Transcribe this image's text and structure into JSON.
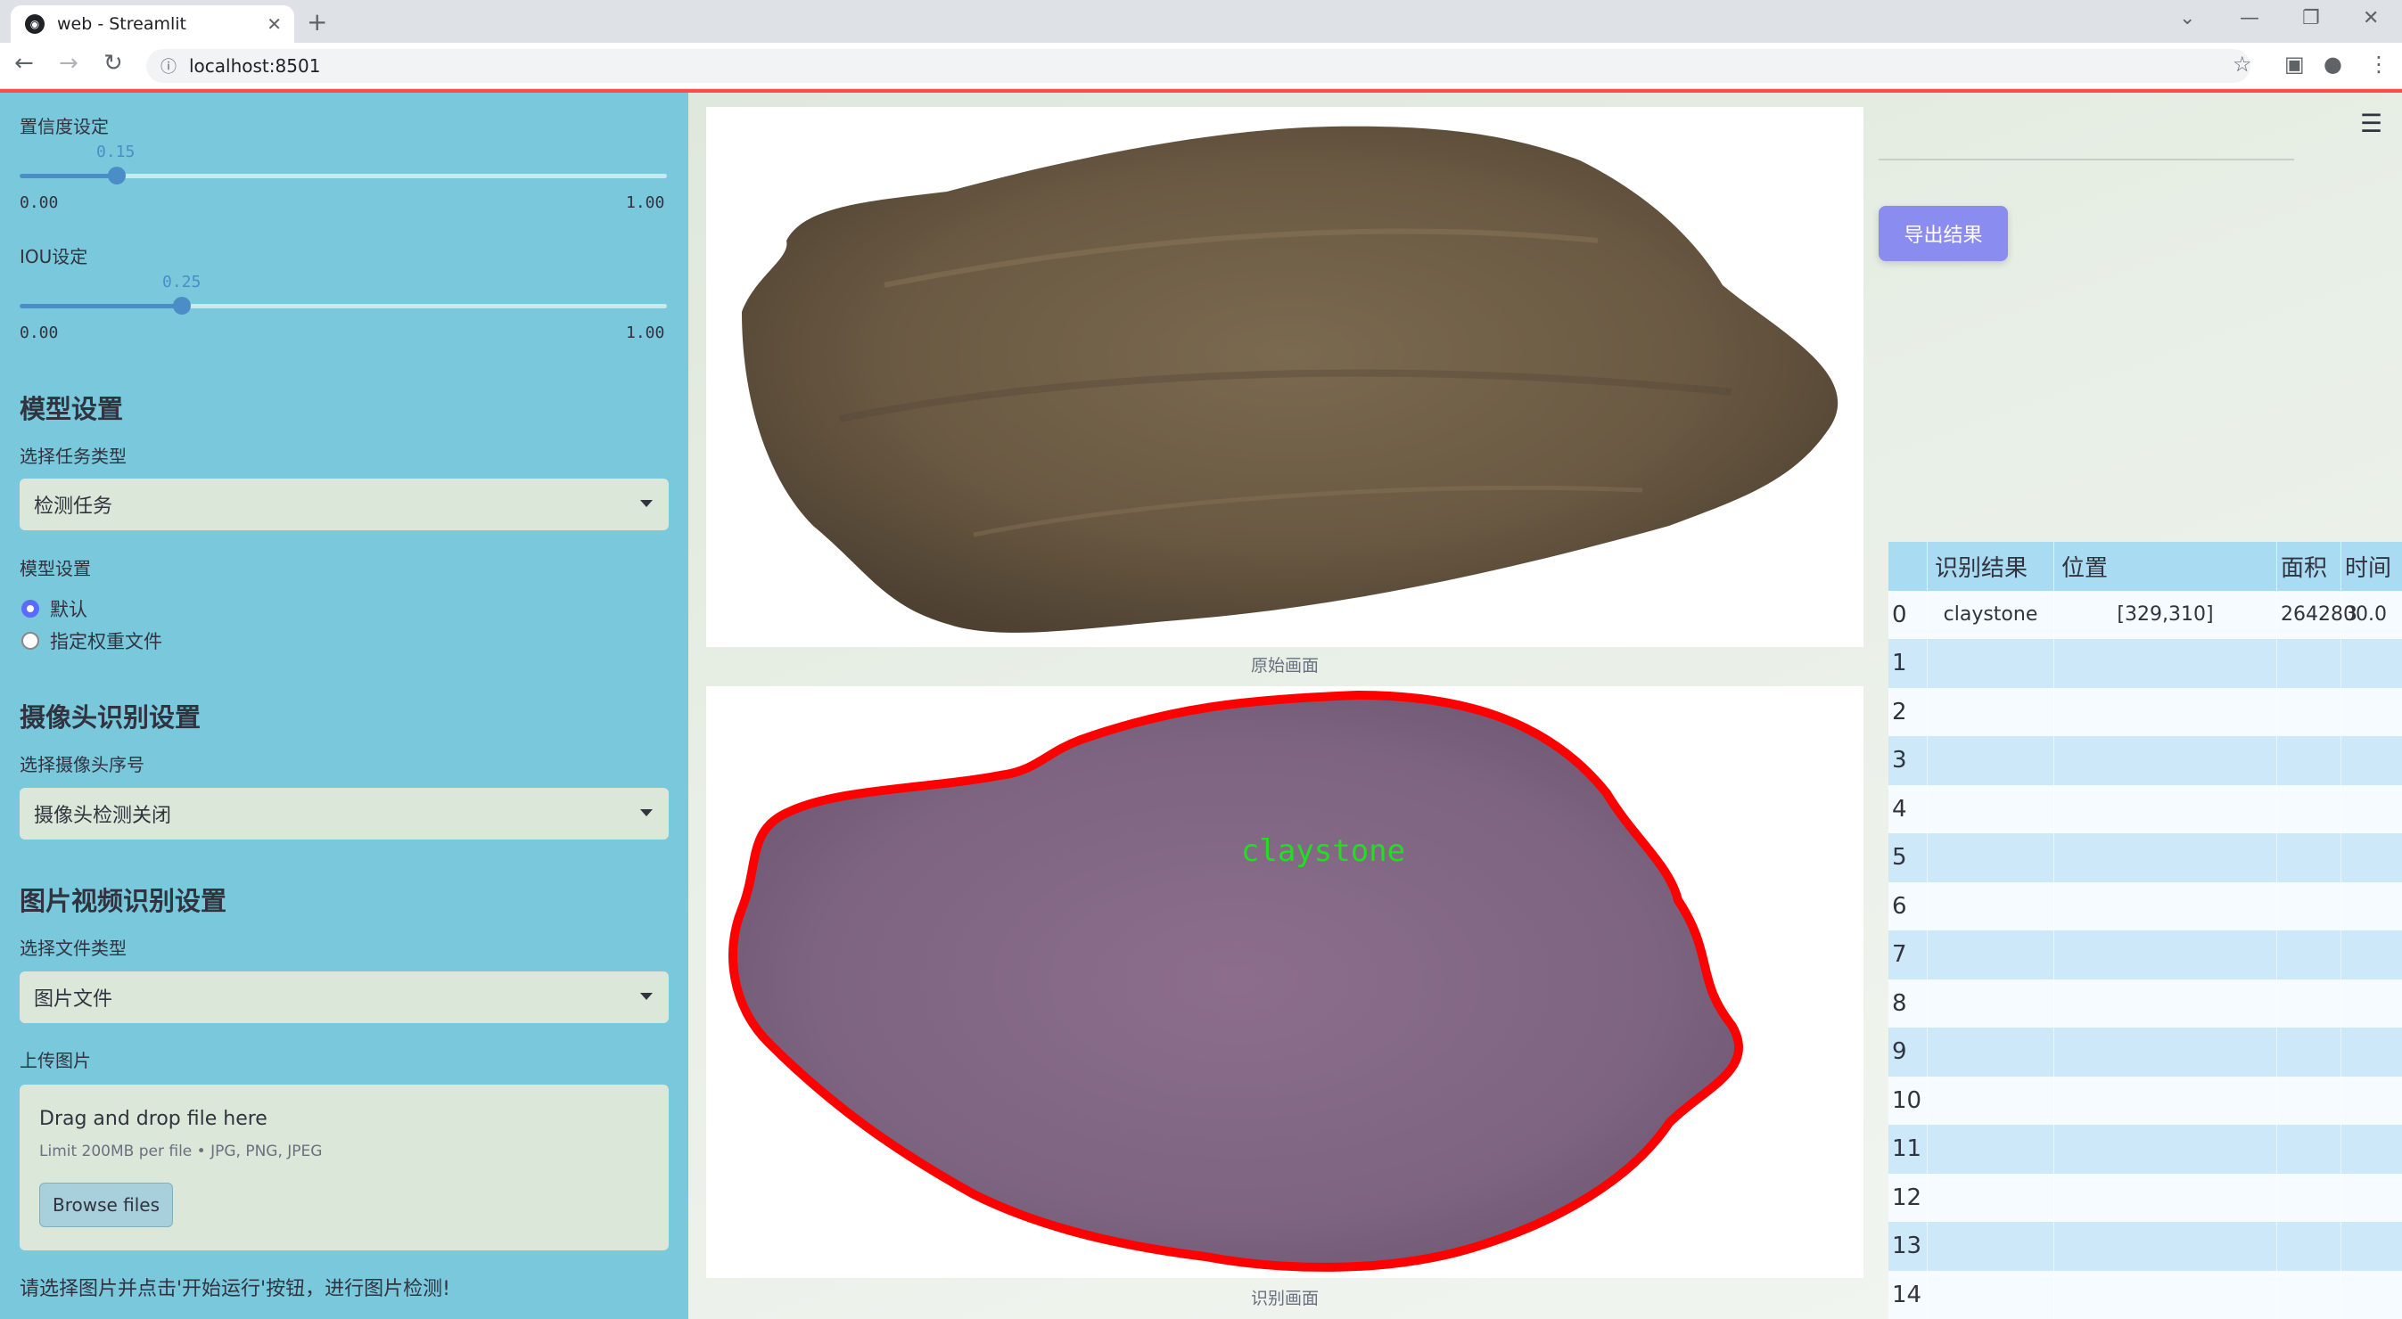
{
  "browser": {
    "tab_title": "web - Streamlit",
    "url": "localhost:8501",
    "new_tab_symbol": "+",
    "close_symbol": "✕"
  },
  "sidebar": {
    "confidence": {
      "label": "置信度设定",
      "value": 0.15,
      "value_text": "0.15",
      "min_text": "0.00",
      "max_text": "1.00"
    },
    "iou": {
      "label": "IOU设定",
      "value": 0.25,
      "value_text": "0.25",
      "min_text": "0.00",
      "max_text": "1.00"
    },
    "model_heading": "模型设置",
    "task_label": "选择任务类型",
    "task_value": "检测任务",
    "model_label": "模型设置",
    "model_options": [
      {
        "label": "默认",
        "selected": true
      },
      {
        "label": "指定权重文件",
        "selected": false
      }
    ],
    "camera_heading": "摄像头识别设置",
    "camera_label": "选择摄像头序号",
    "camera_value": "摄像头检测关闭",
    "media_heading": "图片视频识别设置",
    "filetype_label": "选择文件类型",
    "filetype_value": "图片文件",
    "upload_label": "上传图片",
    "uploader": {
      "title": "Drag and drop file here",
      "limit": "Limit 200MB per file • JPG, PNG, JPEG",
      "button": "Browse files"
    },
    "note": "请选择图片并点击'开始运行'按钮，进行图片检测!"
  },
  "main": {
    "original_caption": "原始画面",
    "result_caption": "识别画面",
    "detection_label": "claystone",
    "export_button": "导出结果",
    "table": {
      "headers": [
        "",
        "识别结果",
        "位置",
        "面积",
        "时间"
      ],
      "rows": [
        {
          "index": "0",
          "result": "claystone",
          "position": "[329,310]",
          "area": "2642800.0",
          "time": "3"
        },
        {
          "index": "1",
          "result": "",
          "position": "",
          "area": "",
          "time": ""
        },
        {
          "index": "2",
          "result": "",
          "position": "",
          "area": "",
          "time": ""
        },
        {
          "index": "3",
          "result": "",
          "position": "",
          "area": "",
          "time": ""
        },
        {
          "index": "4",
          "result": "",
          "position": "",
          "area": "",
          "time": ""
        },
        {
          "index": "5",
          "result": "",
          "position": "",
          "area": "",
          "time": ""
        },
        {
          "index": "6",
          "result": "",
          "position": "",
          "area": "",
          "time": ""
        },
        {
          "index": "7",
          "result": "",
          "position": "",
          "area": "",
          "time": ""
        },
        {
          "index": "8",
          "result": "",
          "position": "",
          "area": "",
          "time": ""
        },
        {
          "index": "9",
          "result": "",
          "position": "",
          "area": "",
          "time": ""
        },
        {
          "index": "10",
          "result": "",
          "position": "",
          "area": "",
          "time": ""
        },
        {
          "index": "11",
          "result": "",
          "position": "",
          "area": "",
          "time": ""
        },
        {
          "index": "12",
          "result": "",
          "position": "",
          "area": "",
          "time": ""
        },
        {
          "index": "13",
          "result": "",
          "position": "",
          "area": "",
          "time": ""
        },
        {
          "index": "14",
          "result": "",
          "position": "",
          "area": "",
          "time": ""
        }
      ]
    }
  },
  "colors": {
    "sidebar_bg": "#7ac8dc",
    "accent_red": "#ff4b4b",
    "slider_blue": "#4b8ec7",
    "export_button": "#8b8cf0",
    "detection_outline": "#ff0000",
    "detection_text": "#22dd22"
  }
}
